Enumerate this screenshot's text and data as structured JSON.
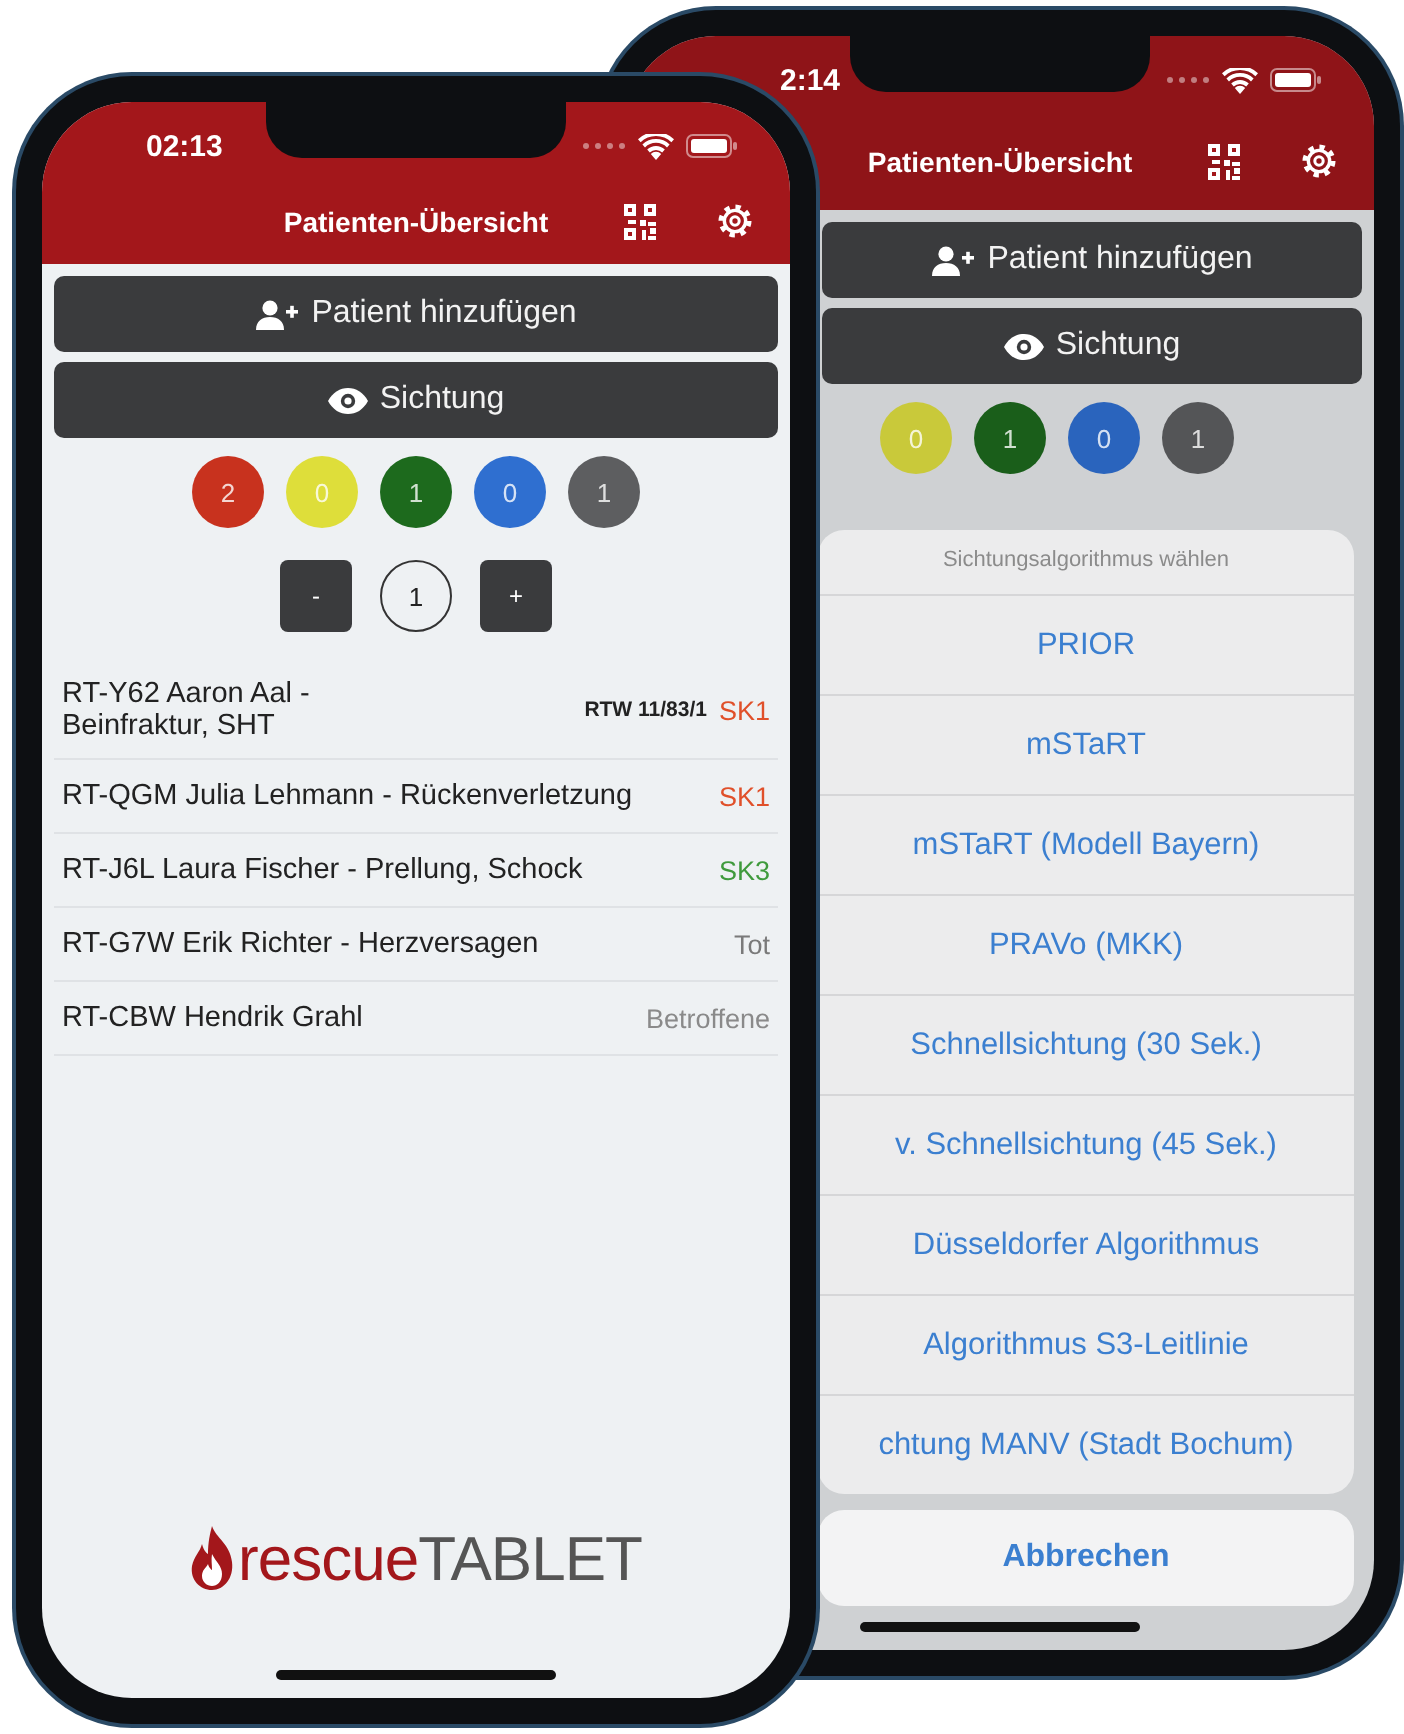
{
  "front_phone": {
    "status_bar": {
      "time": "02:13"
    },
    "header": {
      "title": "Patienten-Übersicht"
    },
    "buttons": [
      {
        "label": "Patient hinzufügen",
        "kind": "add-person"
      },
      {
        "label": "Sichtung",
        "kind": "eye"
      }
    ],
    "triage_counts": [
      {
        "count": "2",
        "color": "#c8321e"
      },
      {
        "count": "0",
        "color": "#dede3a"
      },
      {
        "count": "1",
        "color": "#1d6a1d"
      },
      {
        "count": "0",
        "color": "#2f6fd0"
      },
      {
        "count": "1",
        "color": "#5d5e60"
      }
    ],
    "stepper": {
      "minus": "-",
      "value": "1",
      "plus": "+"
    },
    "patients": [
      {
        "name": "RT-Y62 Aaron Aal - Beinfraktur, SHT",
        "vehicle": "RTW 11/83/1",
        "category": "SK1",
        "color": "#e0502a"
      },
      {
        "name": "RT-QGM Julia Lehmann - Rückenverletzung",
        "category": "SK1",
        "color": "#e0502a"
      },
      {
        "name": "RT-J6L Laura Fischer - Prellung, Schock",
        "category": "SK3",
        "color": "#3f9a3c"
      },
      {
        "name": "RT-G7W Erik Richter - Herzversagen",
        "category": "Tot",
        "color": "#7a7a7a"
      },
      {
        "name": "RT-CBW Hendrik Grahl",
        "category": "Betroffene",
        "color": "#8a8a8a"
      }
    ],
    "logo": {
      "first_part": "rescue",
      "second_part": "TABLET"
    }
  },
  "back_phone": {
    "status_bar": {
      "time": "2:14"
    },
    "header": {
      "title": "Patienten-Übersicht"
    },
    "buttons": [
      {
        "label": "Patient hinzufügen",
        "kind": "add-person"
      },
      {
        "label": "Sichtung",
        "kind": "eye"
      }
    ],
    "triage_counts": [
      {
        "count": "0",
        "color": "#c9c93a"
      },
      {
        "count": "1",
        "color": "#1a5e1a"
      },
      {
        "count": "0",
        "color": "#2a64bd"
      },
      {
        "count": "1",
        "color": "#545557"
      }
    ],
    "action_sheet": {
      "title": "Sichtungsalgorithmus wählen",
      "options": [
        "PRIOR",
        "mSTaRT",
        "mSTaRT (Modell Bayern)",
        "PRAVo (MKK)",
        "Schnellsichtung (30 Sek.)",
        "v. Schnellsichtung (45 Sek.)",
        "Düsseldorfer Algorithmus",
        "Algorithmus S3-Leitlinie",
        "chtung MANV (Stadt Bochum)"
      ],
      "cancel": "Abbrechen"
    }
  }
}
